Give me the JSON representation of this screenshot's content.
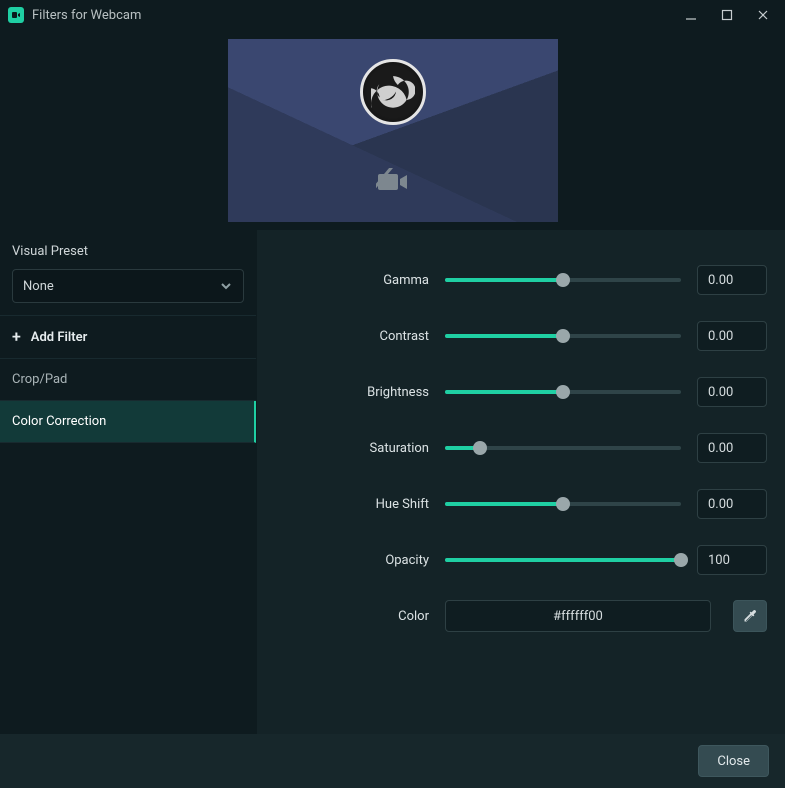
{
  "window": {
    "title": "Filters for Webcam"
  },
  "sidebar": {
    "preset_label": "Visual Preset",
    "preset_value": "None",
    "add_filter_label": "Add Filter",
    "filters": [
      {
        "label": "Crop/Pad",
        "active": false
      },
      {
        "label": "Color Correction",
        "active": true
      }
    ]
  },
  "properties": {
    "rows": [
      {
        "label": "Gamma",
        "fill": 50,
        "value": "0.00"
      },
      {
        "label": "Contrast",
        "fill": 50,
        "value": "0.00"
      },
      {
        "label": "Brightness",
        "fill": 50,
        "value": "0.00"
      },
      {
        "label": "Saturation",
        "fill": 15,
        "value": "0.00"
      },
      {
        "label": "Hue Shift",
        "fill": 50,
        "value": "0.00"
      },
      {
        "label": "Opacity",
        "fill": 100,
        "value": "100"
      }
    ],
    "color_label": "Color",
    "color_value": "#ffffff00"
  },
  "footer": {
    "close_label": "Close"
  },
  "colors": {
    "accent": "#1fcfa3",
    "panel_dark": "#0e1b1f",
    "panel_mid": "#142327"
  }
}
